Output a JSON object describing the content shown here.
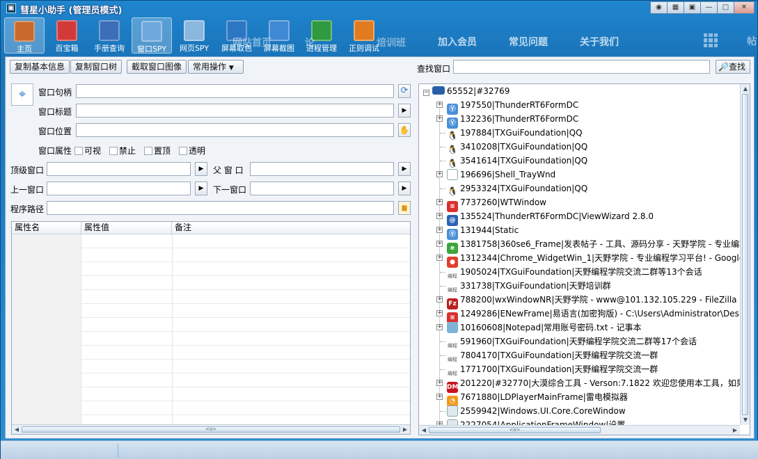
{
  "window": {
    "title": "彗星小助手 (管理员模式)",
    "controls": [
      "◉",
      "▦",
      "▣",
      "—",
      "□",
      "✕"
    ]
  },
  "toolbar": {
    "items": [
      {
        "label": "主页",
        "icon": "home-icon",
        "color": "#c86a2c"
      },
      {
        "label": "百宝箱",
        "icon": "cubes-icon",
        "color": "#d23a3a"
      },
      {
        "label": "手册查询",
        "icon": "help-book-icon",
        "color": "#3b6fb9"
      },
      {
        "label": "窗口SPY",
        "icon": "window-spy-icon",
        "color": "#6fa8dc"
      },
      {
        "label": "网页SPY",
        "icon": "web-spy-icon",
        "color": "#8ab7de"
      },
      {
        "label": "屏幕取色",
        "icon": "color-picker-icon",
        "color": "#2c76c4"
      },
      {
        "label": "屏幕截图",
        "icon": "screenshot-icon",
        "color": "#3f88d4"
      },
      {
        "label": "进程管理",
        "icon": "process-icon",
        "color": "#2f9a3f"
      },
      {
        "label": "正则调试",
        "icon": "regex-icon",
        "color": "#e07b1f"
      }
    ],
    "ghost_texts": [
      "网站首页",
      "论",
      "培训班"
    ],
    "nav_links": [
      "加入会员",
      "常见问题",
      "关于我们"
    ],
    "right_cut_text": "帖"
  },
  "actions": {
    "copy_basic": "复制基本信息",
    "copy_tree": "复制窗口树",
    "capture_image": "截取窗口图像",
    "common_ops": "常用操作",
    "find_window_label": "查找窗口",
    "find_value": "",
    "find_button": "查找"
  },
  "form": {
    "handle_label": "窗口句柄",
    "title_label": "窗口标题",
    "position_label": "窗口位置",
    "attr_label": "窗口属性",
    "attrs": [
      "可视",
      "禁止",
      "置顶",
      "透明"
    ],
    "top_window_label": "顶级窗口",
    "parent_label": "父 窗 口",
    "prev_label": "上一窗口",
    "next_label": "下一窗口",
    "path_label": "程序路径",
    "handle": "",
    "title": "",
    "position": "",
    "top_window": "",
    "parent": "",
    "prev": "",
    "next": "",
    "path": ""
  },
  "table": {
    "headers": [
      "属性名",
      "属性值",
      "备注"
    ],
    "scroll_label": "<o>"
  },
  "tree": {
    "root": "65552|#32769",
    "scroll_label": "<o>",
    "nodes": [
      {
        "text": "197550|ThunderRT6FormDC",
        "icon": "thunder-icon",
        "color": "#4a8fd9",
        "glyph": "Ⓥ",
        "expandable": true
      },
      {
        "text": "132236|ThunderRT6FormDC",
        "icon": "thunder-icon",
        "color": "#4a8fd9",
        "glyph": "Ⓥ",
        "expandable": true
      },
      {
        "text": "197884|TXGuiFoundation|QQ",
        "icon": "qq-penguin-icon",
        "color": "#222",
        "glyph": "🐧",
        "expandable": false
      },
      {
        "text": "3410208|TXGuiFoundation|QQ",
        "icon": "qq-penguin-icon",
        "color": "#222",
        "glyph": "🐧",
        "expandable": false
      },
      {
        "text": "3541614|TXGuiFoundation|QQ",
        "icon": "qq-penguin-icon",
        "color": "#222",
        "glyph": "🐧",
        "expandable": false
      },
      {
        "text": "196696|Shell_TrayWnd",
        "icon": "window-icon",
        "color": "#ffffff",
        "glyph": "",
        "expandable": true
      },
      {
        "text": "2953324|TXGuiFoundation|QQ",
        "icon": "qq-penguin-icon",
        "color": "#222",
        "glyph": "🐧",
        "expandable": false
      },
      {
        "text": "7737260|WTWindow",
        "icon": "wt-icon",
        "color": "#d8322f",
        "glyph": "≋",
        "expandable": true
      },
      {
        "text": "135524|ThunderRT6FormDC|ViewWizard 2.8.0",
        "icon": "viewwizard-icon",
        "color": "#2d62b8",
        "glyph": "@",
        "expandable": true
      },
      {
        "text": "131944|Static",
        "icon": "thunder-icon",
        "color": "#4a8fd9",
        "glyph": "Ⓥ",
        "expandable": true
      },
      {
        "text": "1381758|360se6_Frame|发表帖子 - 工具、源码分享 - 天野学院 - 专业编程",
        "icon": "360-browser-icon",
        "color": "#3ca63a",
        "glyph": "e",
        "expandable": true
      },
      {
        "text": "1312344|Chrome_WidgetWin_1|天野学院 - 专业编程学习平台! - Google",
        "icon": "chrome-icon",
        "color": "#e0402f",
        "glyph": "●",
        "expandable": true
      },
      {
        "text": "1905024|TXGuiFoundation|天野编程学院交流二群等13个会话",
        "icon": "group-logo-icon",
        "color": "#777",
        "glyph": "编程",
        "expandable": false
      },
      {
        "text": "331738|TXGuiFoundation|天野培训群",
        "icon": "group-logo-icon",
        "color": "#777",
        "glyph": "编程",
        "expandable": false
      },
      {
        "text": "788200|wxWindowNR|天野学院 - www@101.132.105.229 - FileZilla",
        "icon": "filezilla-icon",
        "color": "#b8211d",
        "glyph": "Fz",
        "expandable": true
      },
      {
        "text": "1249286|ENewFrame|易语言(加密狗版) - C:\\Users\\Administrator\\Desk",
        "icon": "e-language-icon",
        "color": "#d8322f",
        "glyph": "≋",
        "expandable": true
      },
      {
        "text": "10160608|Notepad|常用账号密码.txt - 记事本",
        "icon": "notepad-icon",
        "color": "#7fb2d9",
        "glyph": "",
        "expandable": true
      },
      {
        "text": "591960|TXGuiFoundation|天野编程学院交流二群等17个会话",
        "icon": "group-logo-icon",
        "color": "#777",
        "glyph": "编程",
        "expandable": false
      },
      {
        "text": "7804170|TXGuiFoundation|天野编程学院交流一群",
        "icon": "group-logo-icon",
        "color": "#777",
        "glyph": "编程",
        "expandable": false
      },
      {
        "text": "1771700|TXGuiFoundation|天野编程学院交流一群",
        "icon": "group-logo-icon",
        "color": "#777",
        "glyph": "编程",
        "expandable": false
      },
      {
        "text": "201220|#32770|大漠综合工具 - Verson:7.1822  欢迎您使用本工具，如果",
        "icon": "dm-icon",
        "color": "#c8141e",
        "glyph": "DM",
        "expandable": true
      },
      {
        "text": "7671880|LDPlayerMainFrame|雷电模拟器",
        "icon": "ldplayer-icon",
        "color": "#f39a1e",
        "glyph": "◔",
        "expandable": true
      },
      {
        "text": "2559942|Windows.UI.Core.CoreWindow",
        "icon": "corewindow-icon",
        "color": "#dfe8ef",
        "glyph": "",
        "expandable": false
      },
      {
        "text": "2227054|ApplicationFrameWindow|设置",
        "icon": "window-icon",
        "color": "#dfe8ef",
        "glyph": "",
        "expandable": true
      }
    ]
  }
}
